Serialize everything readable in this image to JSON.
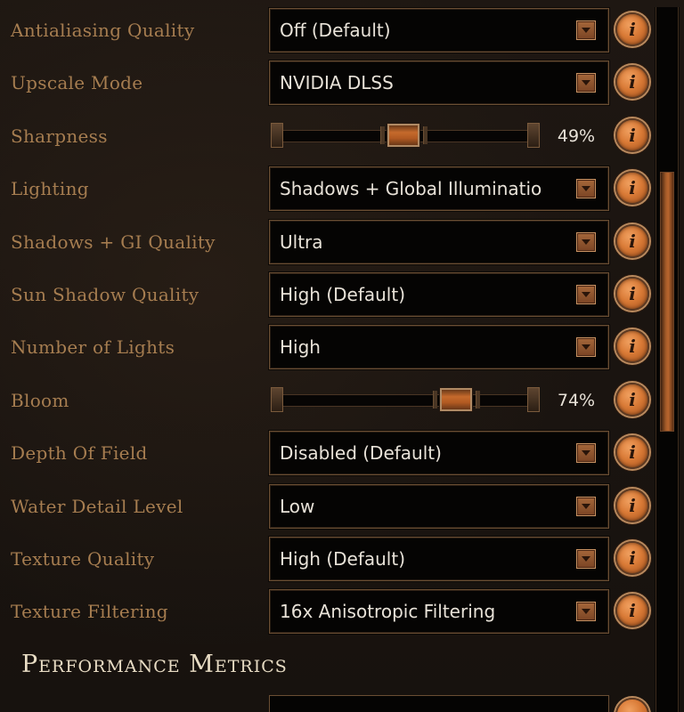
{
  "settings": [
    {
      "kind": "dropdown",
      "label": "Antialiasing Quality",
      "value": "Off (Default)"
    },
    {
      "kind": "dropdown",
      "label": "Upscale Mode",
      "value": "NVIDIA DLSS"
    },
    {
      "kind": "slider",
      "label": "Sharpness",
      "percent": 49,
      "value_text": "49%"
    },
    {
      "kind": "dropdown",
      "label": "Lighting",
      "value": "Shadows + Global Illuminatio"
    },
    {
      "kind": "dropdown",
      "label": "Shadows + GI Quality",
      "value": "Ultra"
    },
    {
      "kind": "dropdown",
      "label": "Sun Shadow Quality",
      "value": "High (Default)"
    },
    {
      "kind": "dropdown",
      "label": "Number of Lights",
      "value": "High"
    },
    {
      "kind": "slider",
      "label": "Bloom",
      "percent": 74,
      "value_text": "74%"
    },
    {
      "kind": "dropdown",
      "label": "Depth Of Field",
      "value": "Disabled (Default)"
    },
    {
      "kind": "dropdown",
      "label": "Water Detail Level",
      "value": "Low"
    },
    {
      "kind": "dropdown",
      "label": "Texture Quality",
      "value": "High (Default)"
    },
    {
      "kind": "dropdown",
      "label": "Texture Filtering",
      "value": "16x Anisotropic Filtering"
    }
  ],
  "section": {
    "title": "Performance Metrics"
  },
  "icons": {
    "info": "i",
    "dropdown_arrow": "chevron-down-icon"
  },
  "colors": {
    "label": "#a67d50",
    "value_text": "#e8e2d8",
    "accent_orange": "#d97a36",
    "panel_bg": "#1a1410",
    "field_bg": "#050403"
  },
  "scroll": {
    "position_fraction": 0.37
  }
}
